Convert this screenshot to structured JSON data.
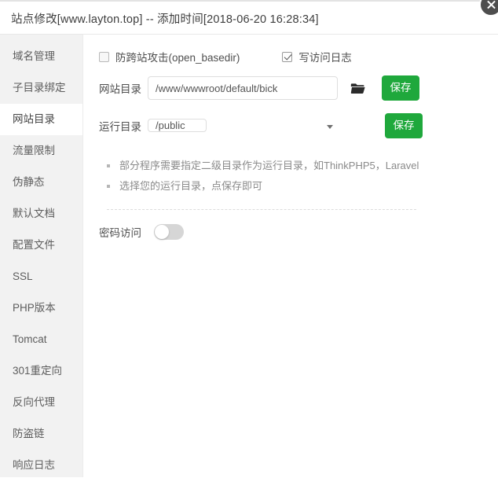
{
  "titlebar": {
    "title": "站点修改[www.layton.top] -- 添加时间[2018-06-20 16:28:34]",
    "close_label": "×"
  },
  "sidebar": {
    "items": [
      {
        "label": "域名管理",
        "active": false
      },
      {
        "label": "子目录绑定",
        "active": false
      },
      {
        "label": "网站目录",
        "active": true
      },
      {
        "label": "流量限制",
        "active": false
      },
      {
        "label": "伪静态",
        "active": false
      },
      {
        "label": "默认文档",
        "active": false
      },
      {
        "label": "配置文件",
        "active": false
      },
      {
        "label": "SSL",
        "active": false
      },
      {
        "label": "PHP版本",
        "active": false
      },
      {
        "label": "Tomcat",
        "active": false
      },
      {
        "label": "301重定向",
        "active": false
      },
      {
        "label": "反向代理",
        "active": false
      },
      {
        "label": "防盗链",
        "active": false
      },
      {
        "label": "响应日志",
        "active": false
      }
    ]
  },
  "main": {
    "checkboxes": [
      {
        "label": "防跨站攻击(open_basedir)",
        "checked": false
      },
      {
        "label": "写访问日志",
        "checked": true
      }
    ],
    "site_dir": {
      "label": "网站目录",
      "value": "/www/wwwroot/default/bick",
      "placeholder": "",
      "browse_icon": "folder-icon",
      "save_label": "保存"
    },
    "run_dir": {
      "label": "运行目录",
      "value": "/public",
      "options": [
        "/public"
      ],
      "caret_icon": "chevron-down-icon",
      "save_label": "保存"
    },
    "hints": [
      "部分程序需要指定二级目录作为运行目录，如ThinkPHP5，Laravel",
      "选择您的运行目录，点保存即可"
    ],
    "password_access": {
      "label": "密码访问",
      "enabled": false
    }
  },
  "colors": {
    "accent_green": "#1fa83c",
    "sidebar_bg": "#f2f2f2",
    "text": "#4f4f4f",
    "hint_text": "#8a8a8a"
  }
}
